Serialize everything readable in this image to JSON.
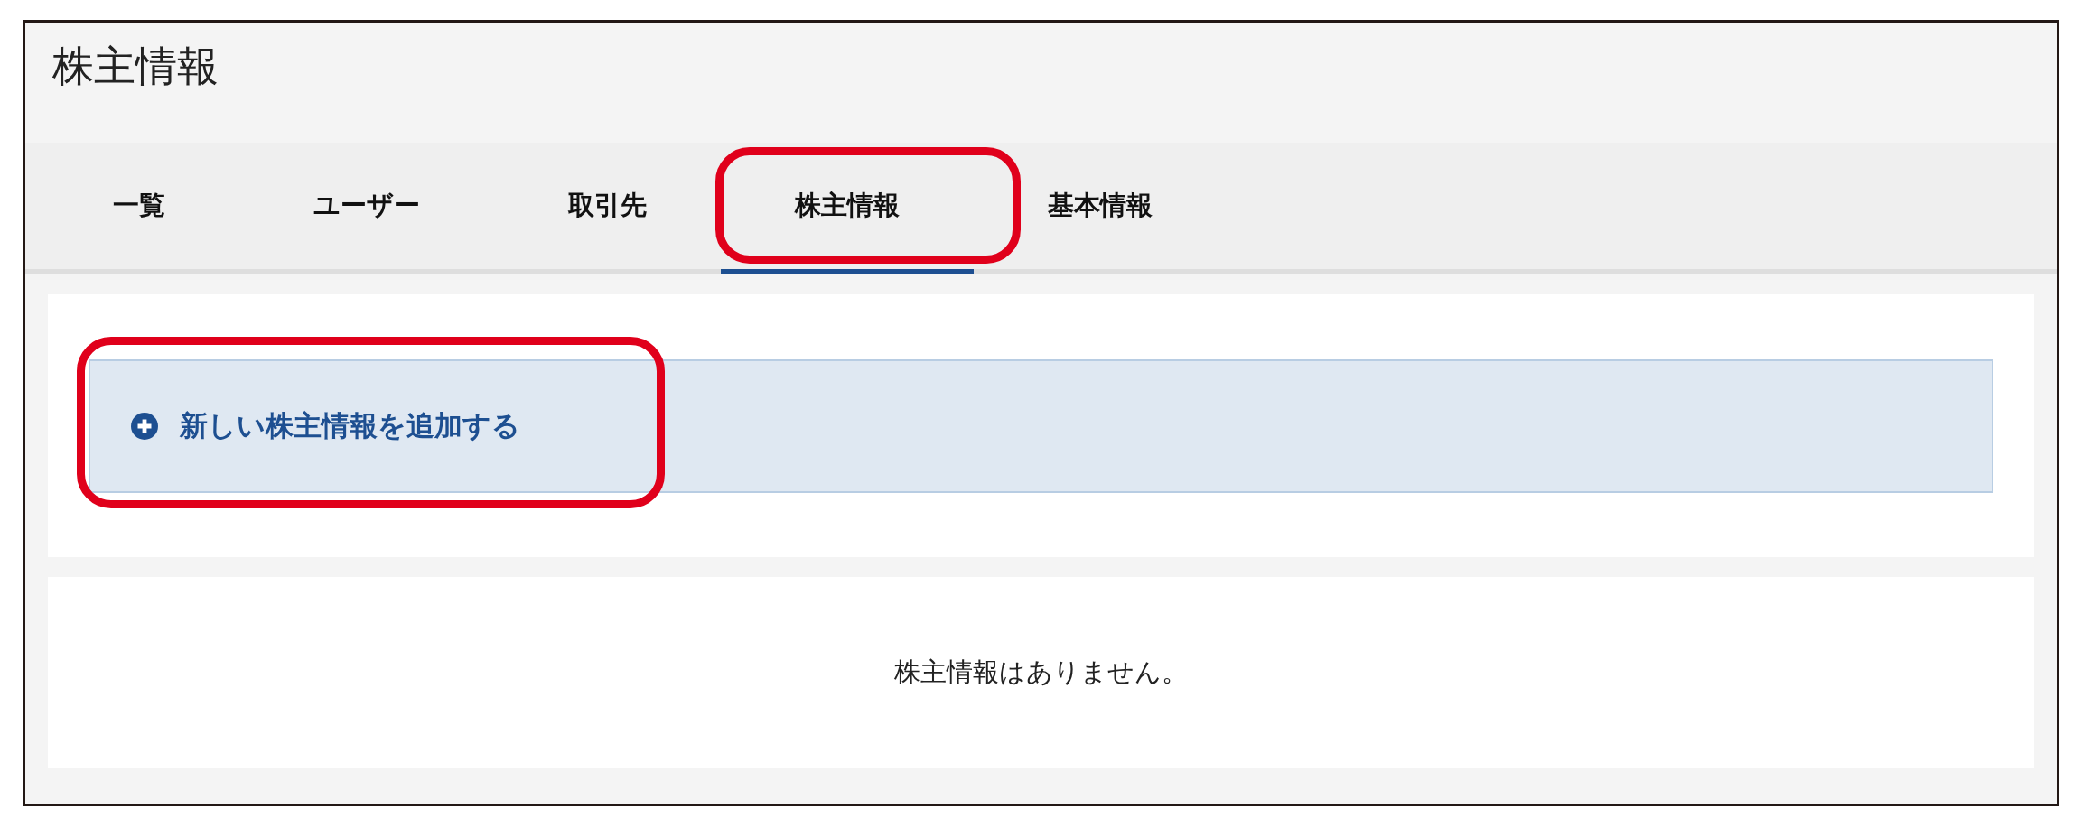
{
  "page_title": "株主情報",
  "tabs": [
    {
      "label": "一覧",
      "selected": false,
      "highlighted": false
    },
    {
      "label": "ユーザー",
      "selected": false,
      "highlighted": false
    },
    {
      "label": "取引先",
      "selected": false,
      "highlighted": false
    },
    {
      "label": "株主情報",
      "selected": true,
      "highlighted": true
    },
    {
      "label": "基本情報",
      "selected": false,
      "highlighted": false
    }
  ],
  "add_button": {
    "label": "新しい株主情報を追加する",
    "highlighted": true
  },
  "empty_message": "株主情報はありません。"
}
